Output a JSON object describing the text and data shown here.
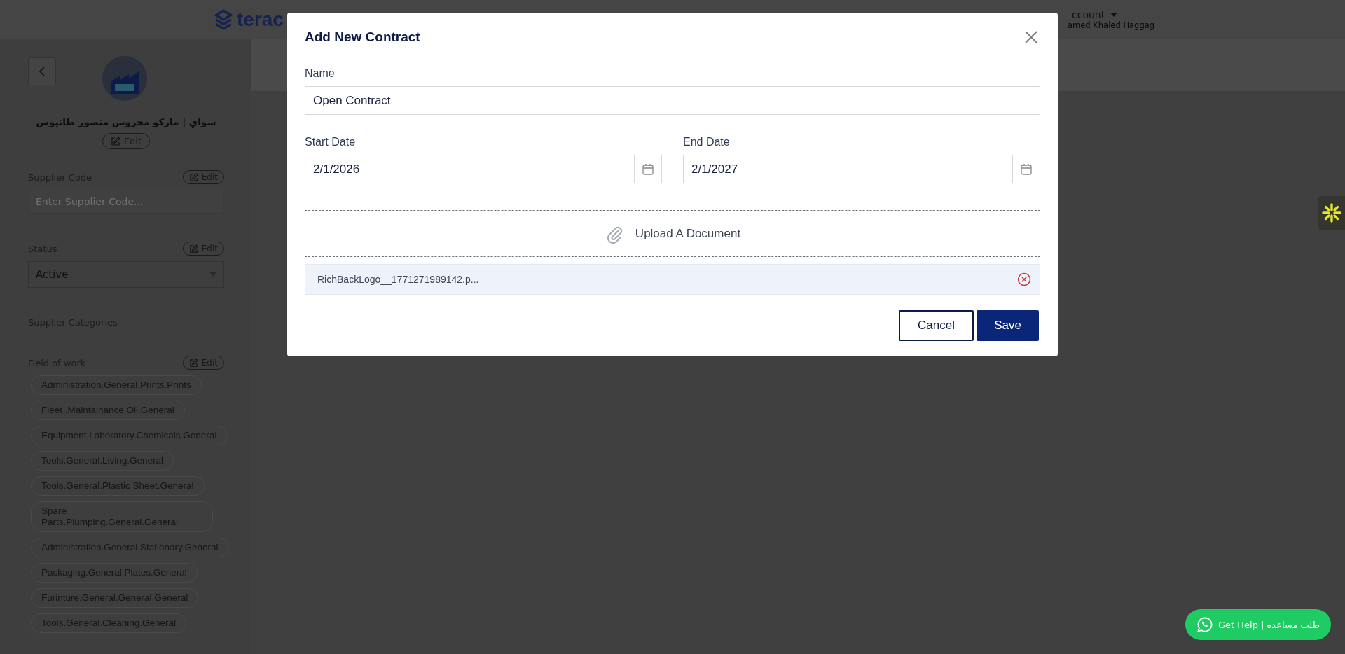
{
  "header": {
    "logo_text": "terac",
    "account": "ccount",
    "user_name": "amed Khaled Haggag"
  },
  "sidebar": {
    "supplier_name": "سواي | ماركو محروس منصور طانيوس",
    "name_edit": "Edit",
    "supplier_code": {
      "label": "Supplier Code",
      "edit": "Edit",
      "placeholder": "Enter Supplier Code..."
    },
    "status": {
      "label": "Status",
      "edit": "Edit",
      "value": "Active"
    },
    "categories_label": "Supplier Categories",
    "field_of_work": {
      "label": "Field of work",
      "edit": "Edit",
      "items": [
        "Administration.General.Prints.Prints",
        "Fleet .Maintainance.Oil.General",
        "Equipment.Laboratory.Chemicals.General",
        "Tools.General.Living.General",
        "Tools.General.Plastic Sheet.General",
        "Spare Parts.Plumping.General.General",
        "Administration.General.Stationary.General",
        "Packaging.General.Plates.General",
        "Furinture.General.General.General",
        "Tools.General.Cleaning.General"
      ]
    }
  },
  "dialog": {
    "title": "Add New Contract",
    "name": {
      "label": "Name",
      "value": "Open Contract"
    },
    "start_date": {
      "label": "Start Date",
      "value": "2/1/2026"
    },
    "end_date": {
      "label": "End Date",
      "value": "2/1/2027"
    },
    "upload": "Upload A Document",
    "file": "RichBackLogo__1771271989142.p...",
    "buttons": [
      {
        "label": "Cancel",
        "kind": "secondary"
      },
      {
        "label": "Save",
        "kind": "primary"
      }
    ]
  },
  "help_button": "Get Help | طلب مساعده"
}
